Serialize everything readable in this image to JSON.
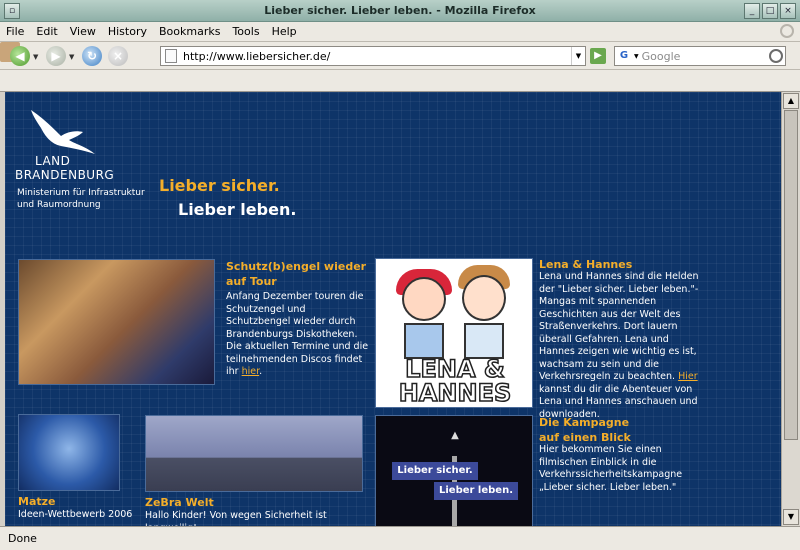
{
  "window": {
    "title": "Lieber sicher. Lieber leben. - Mozilla Firefox"
  },
  "menu": [
    "File",
    "Edit",
    "View",
    "History",
    "Bookmarks",
    "Tools",
    "Help"
  ],
  "toolbar": {
    "url": "http://www.liebersicher.de/",
    "search_placeholder": "Google",
    "search_engine_letter": "G"
  },
  "page": {
    "logo": {
      "line1": "LAND",
      "line2": "BRANDENBURG",
      "ministry1": "Ministerium für Infrastruktur",
      "ministry2": "und Raumordnung"
    },
    "slogan": {
      "line1": "Lieber sicher.",
      "line2": "Lieber leben."
    },
    "schutzengel": {
      "title": "Schutz(b)engel wieder auf Tour",
      "text": "Anfang Dezember touren die Schutzengel und Schutzbengel wieder durch Brandenburgs Diskotheken. Die aktuellen Termine und die teilnehmenden Discos findet ihr",
      "link": "hier",
      "suffix": "."
    },
    "lena": {
      "title": "Lena & Hannes",
      "text": "Lena und Hannes sind die Helden der \"Lieber sicher. Lieber leben.\"-Mangas mit spannenden Geschichten aus der Welt des Straßenverkehrs. Dort lauern überall Gefahren. Lena und Hannes zeigen wie wichtig es ist, wachsam zu sein und die Verkehrsregeln zu beachten.",
      "link": "Hier",
      "text2": "kannst du dir die Abenteuer von Lena und Hannes anschauen und downloaden.",
      "image_title": "LENA & HANNES"
    },
    "matze": {
      "title": "Matze",
      "text": "Ideen-Wettbewerb 2006"
    },
    "zebra": {
      "title": "ZeBra Welt",
      "text": "Hallo Kinder! Von wegen Sicherheit ist langweilig!"
    },
    "kampagne": {
      "title": "Die Kampagne auf einen Blick",
      "text": "Hier bekommen Sie einen filmischen Einblick in die Verkehrssicherheitskampagne „Lieber sicher. Lieber leben.\"",
      "sign1": "Lieber sicher.",
      "sign2": "Lieber leben."
    }
  },
  "status": "Done"
}
